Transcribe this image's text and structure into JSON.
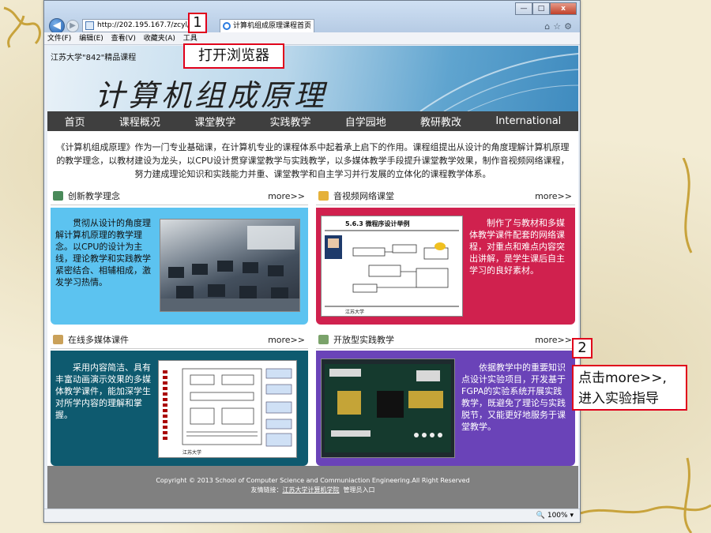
{
  "browser": {
    "url": "http://202.195.167.7/zcyl/",
    "tab_title": "计算机组成原理课程首页",
    "tab_close": "×",
    "menu": [
      "文件(F)",
      "编辑(E)",
      "查看(V)",
      "收藏夹(A)",
      "工具"
    ],
    "window_min": "—",
    "window_max": "□",
    "window_close": "x",
    "tool_icons": "⌂☆⚙",
    "zoom": "100%"
  },
  "site": {
    "subtitle": "江苏大学\"842\"精品课程",
    "title": "计算机组成原理",
    "nav": [
      "首页",
      "课程概况",
      "课堂教学",
      "实践教学",
      "自学园地",
      "教研教改",
      "International"
    ],
    "intro": "《计算机组成原理》作为一门专业基础课，在计算机专业的课程体系中起着承上启下的作用。课程组提出从设计的角度理解计算机原理的教学理念，以教材建设为龙头，以CPU设计贯穿课堂教学与实践教学，以多媒体教学手段提升课堂教学效果，制作音视频网络课程，努力建成理论知识和实践能力并重、课堂教学和自主学习并行发展的立体化的课程教学体系。",
    "panels": [
      {
        "title": "创新教学理念",
        "more": "more>>",
        "text": "贯彻从设计的角度理解计算机原理的教学理念。以CPU的设计为主线，理论教学和实践教学紧密结合、相辅相成，激发学习热情。",
        "color": "#5cc3f0",
        "textcolor": "#111"
      },
      {
        "title": "音视频网络课堂",
        "more": "more>>",
        "text": "制作了与教材和多媒体教学课件配套的网络课程，对重点和难点内容突出讲解，是学生课后自主学习的良好素材。",
        "color": "#d0214e",
        "textcolor": "#fff"
      },
      {
        "title": "在线多媒体课件",
        "more": "more>>",
        "text": "采用内容简洁、具有丰富动画演示效果的多媒体教学课件，能加深学生对所学内容的理解和掌握。",
        "color": "#0e5a6f",
        "textcolor": "#fff"
      },
      {
        "title": "开放型实践教学",
        "more": "more>>",
        "text": "依据教学中的重要知识点设计实验项目，开发基于FGPA的实验系统开展实践教学，既避免了理论与实践脱节，又能更好地服务于课堂教学。",
        "color": "#6a43b8",
        "textcolor": "#fff"
      }
    ],
    "footer_line1": "Copyright © 2013 School of Computer Science and Communiaction Engineering.All Right Reserved",
    "footer_prefix": "友情链接：",
    "footer_link": "江苏大学计算机学院",
    "footer_admin": "管理员入口"
  },
  "slide_images": {
    "video_slide_heading": "5.6.3 微程序设计举例",
    "video_slide_school": "江苏大学",
    "courseware_school": "江苏大学"
  },
  "callouts": [
    {
      "num": "1",
      "text": "打开浏览器"
    },
    {
      "num": "2",
      "text": "点击more>>,\n进入实验指导"
    }
  ]
}
